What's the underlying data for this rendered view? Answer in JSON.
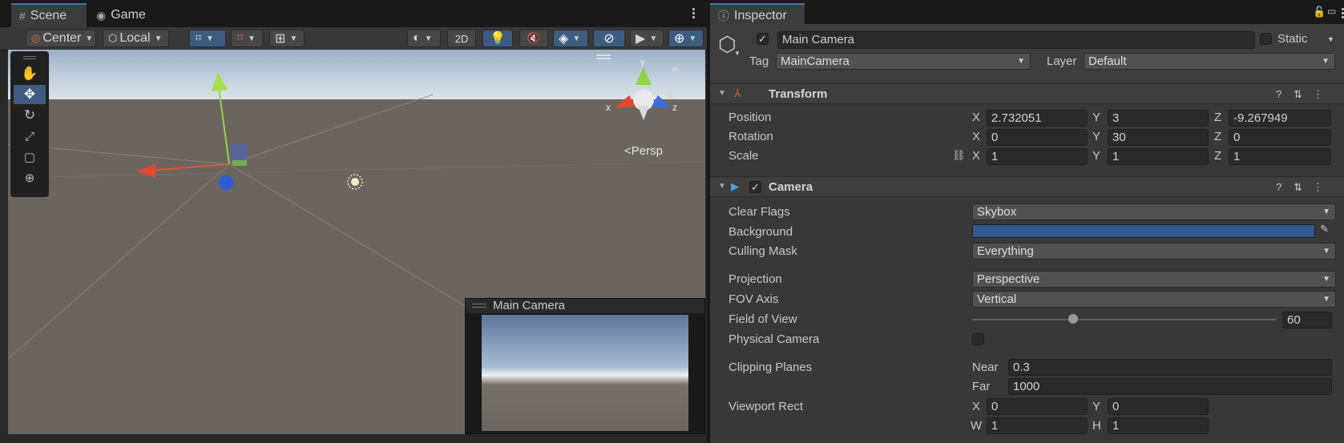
{
  "scene": {
    "tabs": [
      {
        "label": "Scene",
        "icon": "grid-icon"
      },
      {
        "label": "Game",
        "icon": "gamepad-icon"
      }
    ],
    "toolbar": {
      "pivot_label": "Center",
      "space_label": "Local",
      "mode_2d_label": "2D"
    },
    "persp_label": "Persp",
    "gizmo_axes": {
      "x": "x",
      "y": "y",
      "z": "z"
    },
    "camera_preview_title": "Main Camera"
  },
  "inspector": {
    "tab_label": "Inspector",
    "object": {
      "name": "Main Camera",
      "static_label": "Static",
      "tag_label": "Tag",
      "tag_value": "MainCamera",
      "layer_label": "Layer",
      "layer_value": "Default"
    },
    "transform": {
      "title": "Transform",
      "position": {
        "label": "Position",
        "x": "2.732051",
        "y": "3",
        "z": "-9.267949"
      },
      "rotation": {
        "label": "Rotation",
        "x": "0",
        "y": "30",
        "z": "0"
      },
      "scale": {
        "label": "Scale",
        "x": "1",
        "y": "1",
        "z": "1"
      }
    },
    "camera": {
      "title": "Camera",
      "clear_flags": {
        "label": "Clear Flags",
        "value": "Skybox"
      },
      "background": {
        "label": "Background",
        "color": "#30598f"
      },
      "culling_mask": {
        "label": "Culling Mask",
        "value": "Everything"
      },
      "projection": {
        "label": "Projection",
        "value": "Perspective"
      },
      "fov_axis": {
        "label": "FOV Axis",
        "value": "Vertical"
      },
      "field_of_view": {
        "label": "Field of View",
        "value": "60"
      },
      "physical_camera": {
        "label": "Physical Camera"
      },
      "clipping_planes": {
        "label": "Clipping Planes",
        "near_label": "Near",
        "near": "0.3",
        "far_label": "Far",
        "far": "1000"
      },
      "viewport_rect": {
        "label": "Viewport Rect",
        "x": "0",
        "y": "0",
        "w": "1",
        "h": "1"
      }
    },
    "axis_labels": {
      "x": "X",
      "y": "Y",
      "z": "Z",
      "w": "W",
      "h": "H"
    }
  },
  "colors": {
    "accent_blue": "#3a79bb",
    "selected_tool": "#3d5c80"
  }
}
